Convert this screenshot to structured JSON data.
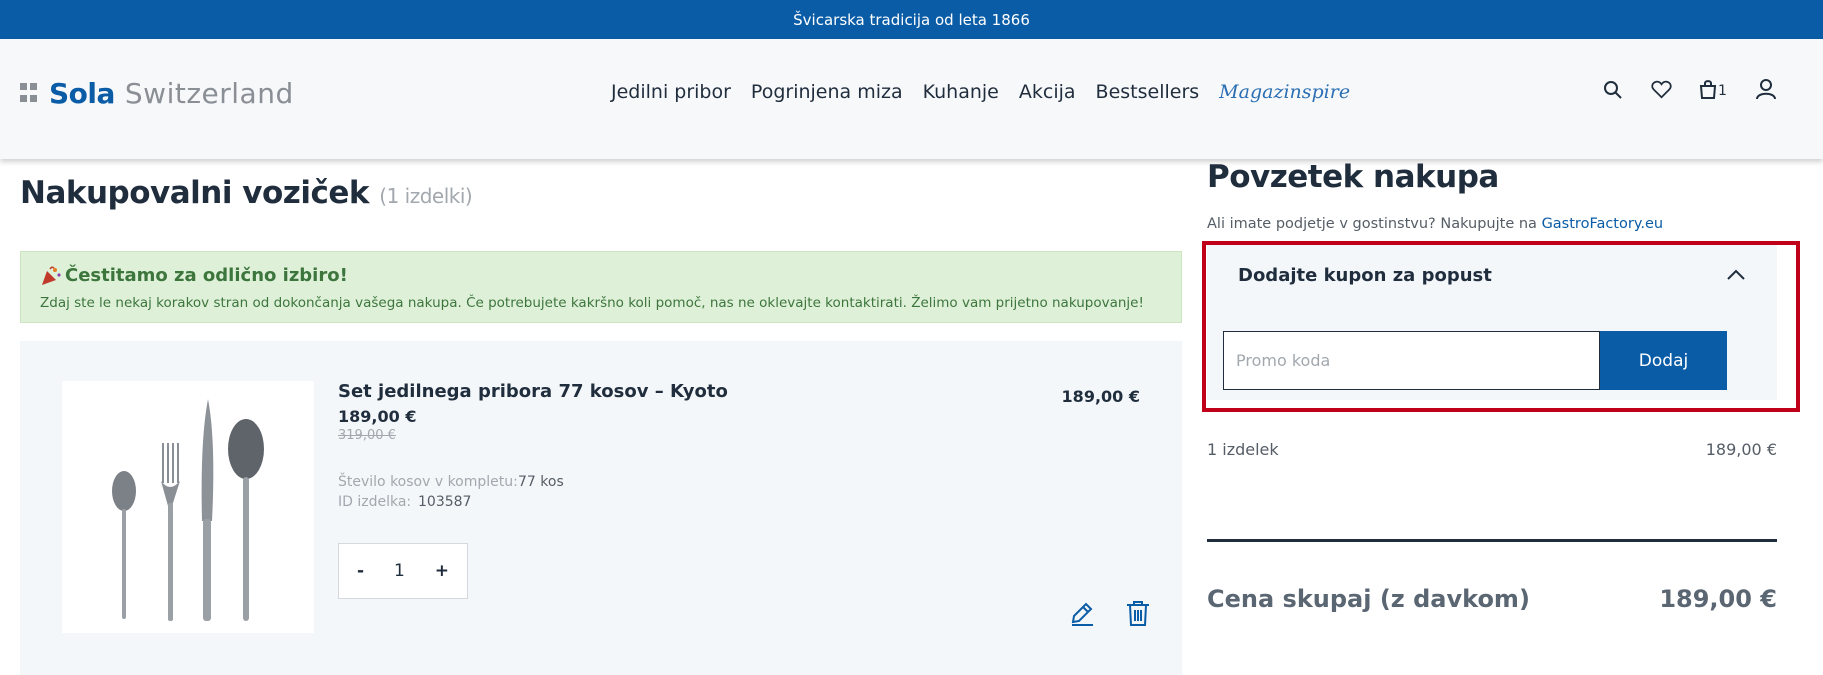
{
  "topbar": {
    "text": "Švicarska tradicija od leta 1866"
  },
  "logo": {
    "brand": "Sola",
    "sub": "Switzerland"
  },
  "nav": {
    "items": [
      "Jedilni pribor",
      "Pogrinjena miza",
      "Kuhanje",
      "Akcija",
      "Bestsellers"
    ],
    "magazine": "Magazinspire"
  },
  "header_icons": {
    "cart_count": "1"
  },
  "cart": {
    "title": "Nakupovalni voziček",
    "count": "(1 izdelki)",
    "success_title": "Čestitamo za odlično izbiro!",
    "success_text": "Zdaj ste le nekaj korakov stran od dokončanja vašega nakupa. Če potrebujete kakršno koli pomoč, nas ne oklevajte kontaktirati. Želimo vam prijetno nakupovanje!",
    "item": {
      "name": "Set jedilnega pribora 77 kosov – Kyoto",
      "price": "189,00 €",
      "old_price": "319,00 €",
      "attr1_label": "Število kosov v kompletu:",
      "attr1_value": "77 kos",
      "attr2_label": "ID izdelka:",
      "attr2_value": "103587",
      "qty_minus": "-",
      "qty": "1",
      "qty_plus": "+",
      "line_total": "189,00 €"
    }
  },
  "summary": {
    "title": "Povzetek nakupa",
    "note_prefix": "Ali imate podjetje v gostinstvu? Nakupujte na",
    "note_link": "GastroFactory.eu",
    "coupon_title": "Dodajte kupon za popust",
    "promo_placeholder": "Promo koda",
    "add_button": "Dodaj",
    "items_label": "1 izdelek",
    "items_value": "189,00 €",
    "total_label": "Cena skupaj (z davkom)",
    "total_value": "189,00 €"
  },
  "colors": {
    "brand": "#0a5ca6",
    "highlight": "#c00019",
    "success_bg": "#dff0d8"
  }
}
